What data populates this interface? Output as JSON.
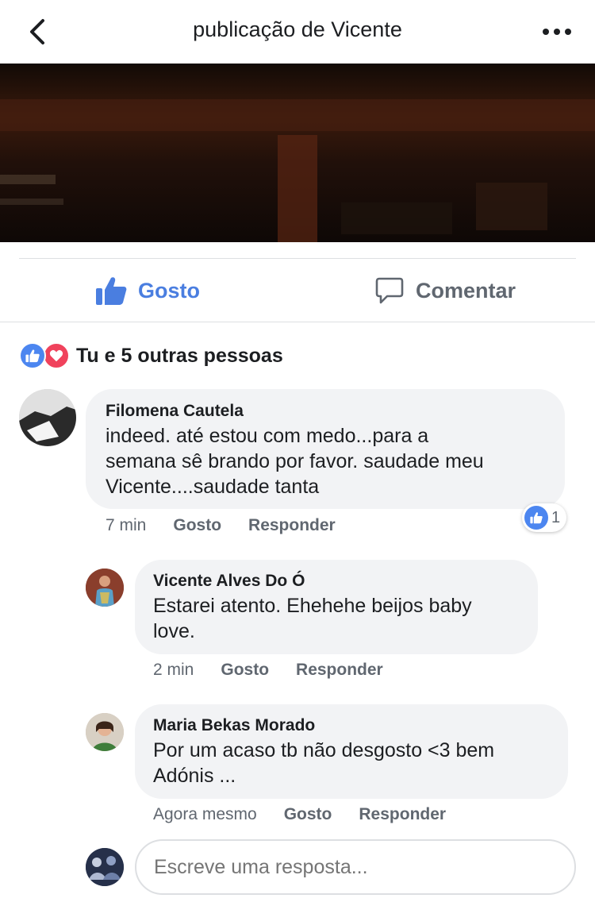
{
  "header": {
    "title": "publicação de Vicente"
  },
  "actions": {
    "like_label": "Gosto",
    "comment_label": "Comentar"
  },
  "reactions": {
    "summary": "Tu e 5 outras pessoas"
  },
  "comments": [
    {
      "author": "Filomena Cautela",
      "lines": [
        "indeed. até estou com medo...para a",
        "semana sê brando por favor.  saudade meu",
        "Vicente....saudade tanta"
      ],
      "time": "7 min",
      "like_label": "Gosto",
      "reply_label": "Responder",
      "like_count": "1"
    },
    {
      "author": "Vicente Alves Do Ó",
      "lines": [
        "Estarei atento. Ehehehe beijos baby",
        "love."
      ],
      "time": "2 min",
      "like_label": "Gosto",
      "reply_label": "Responder"
    },
    {
      "author": "Maria Bekas Morado",
      "lines": [
        "Por um acaso tb não desgosto <3 bem",
        "Adónis ..."
      ],
      "time": "Agora mesmo",
      "like_label": "Gosto",
      "reply_label": "Responder"
    }
  ],
  "reply_box": {
    "placeholder": "Escreve uma resposta..."
  },
  "colors": {
    "accent": "#4a7ee0",
    "love": "#f0425c",
    "bubble": "#f2f3f5",
    "muted": "#606770"
  }
}
